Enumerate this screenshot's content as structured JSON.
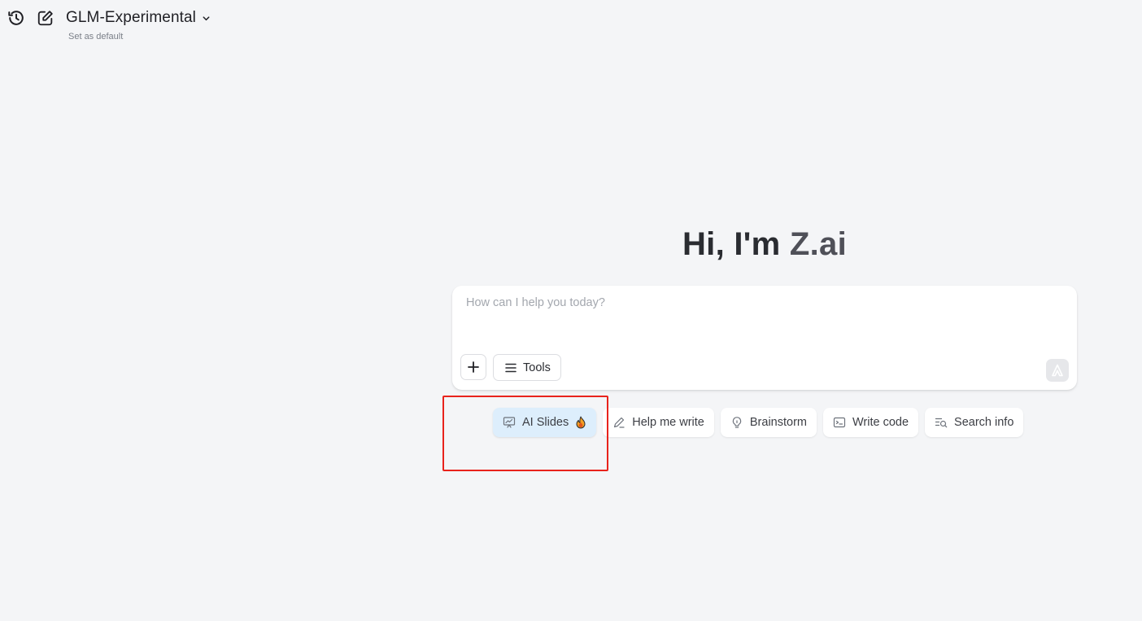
{
  "header": {
    "model_name": "GLM-Experimental",
    "set_default_label": "Set as default",
    "icons": {
      "history": "history-icon",
      "new_chat": "edit-icon",
      "model_dropdown": "chevron-down-icon"
    }
  },
  "greeting": {
    "prefix": "Hi, I'm ",
    "brand": "Z.ai"
  },
  "composer": {
    "placeholder": "How can I help you today?",
    "value": "",
    "tools_label": "Tools",
    "icons": {
      "attach": "plus-icon",
      "tools": "menu-icon",
      "send": "send-icon"
    }
  },
  "suggestions": [
    {
      "label": "AI Slides",
      "icon": "presentation-icon",
      "badge": "flame-icon",
      "active": true
    },
    {
      "label": "Help me write",
      "icon": "pencil-icon",
      "active": false
    },
    {
      "label": "Brainstorm",
      "icon": "lightbulb-icon",
      "active": false
    },
    {
      "label": "Write code",
      "icon": "terminal-icon",
      "active": false
    },
    {
      "label": "Search info",
      "icon": "search-list-icon",
      "active": false
    }
  ],
  "colors": {
    "background": "#f4f5f7",
    "active_chip": "#ddeefc",
    "highlight_box": "#e8231c",
    "brand_text": "#4f5058"
  }
}
